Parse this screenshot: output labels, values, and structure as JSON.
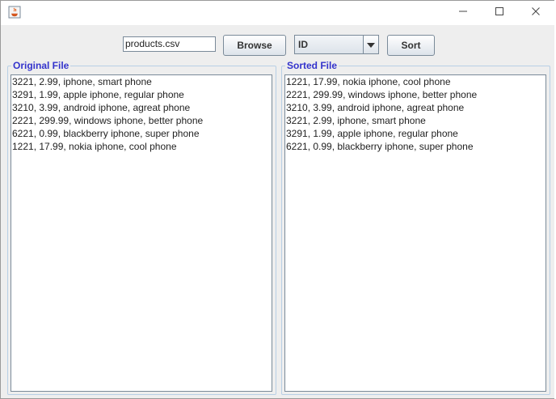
{
  "window": {
    "title": ""
  },
  "toolbar": {
    "file_name": "products.csv",
    "browse_label": "Browse",
    "sort_by": "ID",
    "sort_label": "Sort"
  },
  "original_panel": {
    "title": "Original File",
    "lines": [
      "3221, 2.99, iphone, smart phone",
      "3291, 1.99, apple iphone, regular phone",
      "3210, 3.99, android iphone, agreat phone",
      "2221, 299.99, windows iphone, better phone",
      "6221, 0.99, blackberry iphone, super phone",
      "1221, 17.99, nokia iphone, cool phone"
    ]
  },
  "sorted_panel": {
    "title": "Sorted File",
    "lines": [
      "1221, 17.99, nokia iphone, cool phone",
      "2221, 299.99, windows iphone, better phone",
      "3210, 3.99, android iphone, agreat phone",
      "3221, 2.99, iphone, smart phone",
      "3291, 1.99, apple iphone, regular phone",
      "6221, 0.99, blackberry iphone, super phone"
    ]
  },
  "icons": {
    "app": "java-icon",
    "minimize": "minimize-icon",
    "maximize": "maximize-icon",
    "close": "close-icon",
    "dropdown": "chevron-down-icon"
  },
  "colors": {
    "panel_title": "#3333cc",
    "panel_border": "#b8cfe5",
    "window_bg": "#eeeeee"
  }
}
